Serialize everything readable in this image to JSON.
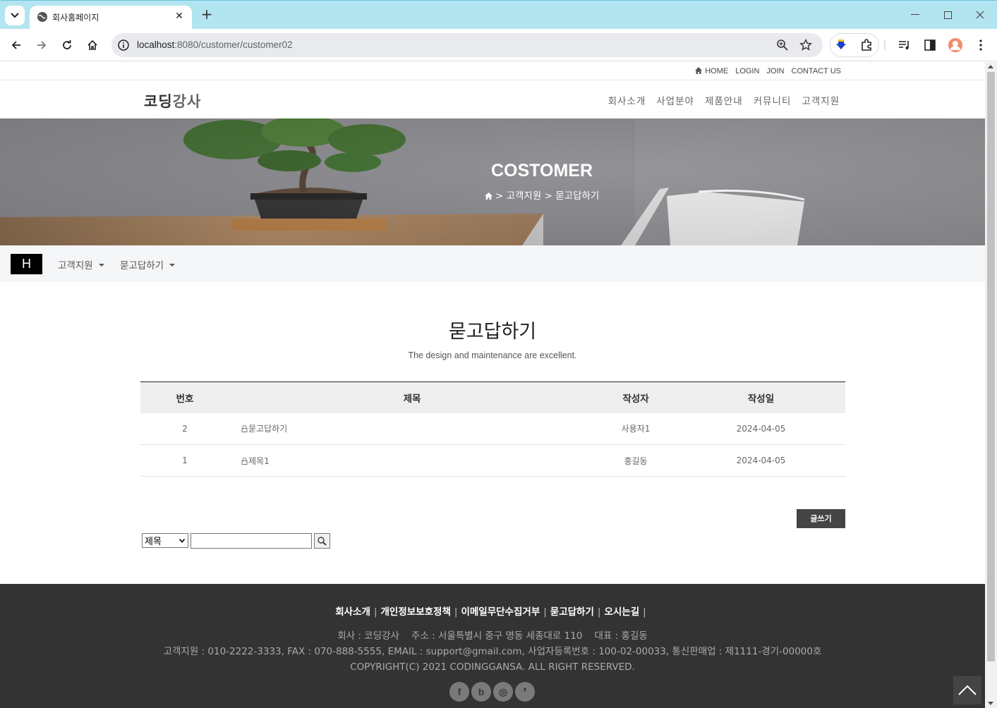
{
  "browser": {
    "tab_title": "회사홈페이지",
    "url_host": "localhost",
    "url_path": ":8080/customer/customer02"
  },
  "top_links": [
    "HOME",
    "LOGIN",
    "JOIN",
    "CONTACT US"
  ],
  "logo": {
    "part1": "코딩",
    "part2": "강사"
  },
  "gnb": [
    "회사소개",
    "사업분야",
    "제품안내",
    "커뮤니티",
    "고객지원"
  ],
  "banner": {
    "title": "COSTOMER",
    "crumb_sep": ">",
    "crumb_1": "고객지원",
    "crumb_2": "묻고답하기"
  },
  "subnav": {
    "home_label": "H",
    "menu1": "고객지원",
    "menu2": "묻고답하기"
  },
  "content": {
    "title": "묻고답하기",
    "subtitle": "The design and maintenance are excellent."
  },
  "table": {
    "headers": [
      "번호",
      "제목",
      "작성자",
      "작성일"
    ],
    "rows": [
      {
        "no": "2",
        "title": "묻고답하기",
        "author": "사용자1",
        "date": "2024-04-05"
      },
      {
        "no": "1",
        "title": "제목1",
        "author": "홍길동",
        "date": "2024-04-05"
      }
    ]
  },
  "write_button": "글쓰기",
  "search": {
    "select_value": "제목",
    "input_value": ""
  },
  "footer": {
    "links": [
      "회사소개",
      "개인정보보호정책",
      "이메일무단수집거부",
      "묻고답하기",
      "오시는길"
    ],
    "separator": "|",
    "line1": "회사 : 코딩강사    주소 : 서울특별시 중구 명동 세종대로 110    대표 : 홍길동",
    "line2": "고객지원 : 010-2222-3333, FAX : 070-888-5555, EMAIL : support@gmail.com, 사업자등록번호 : 100-02-00033, 통신판매업 : 제1111-경기-00000호",
    "line3": "COPYRIGHT(C) 2021 CODINGGANSA. ALL RIGHT RESERVED.",
    "sns": [
      {
        "icon": "facebook-icon",
        "glyph": "f"
      },
      {
        "icon": "blog-icon",
        "glyph": "b"
      },
      {
        "icon": "instagram-icon",
        "glyph": "◎"
      },
      {
        "icon": "kakao-story-icon",
        "glyph": "❜"
      }
    ]
  },
  "colors": {
    "tabbar": "#b3e5f0",
    "footer_bg": "#333333",
    "write_btn": "#444444"
  }
}
